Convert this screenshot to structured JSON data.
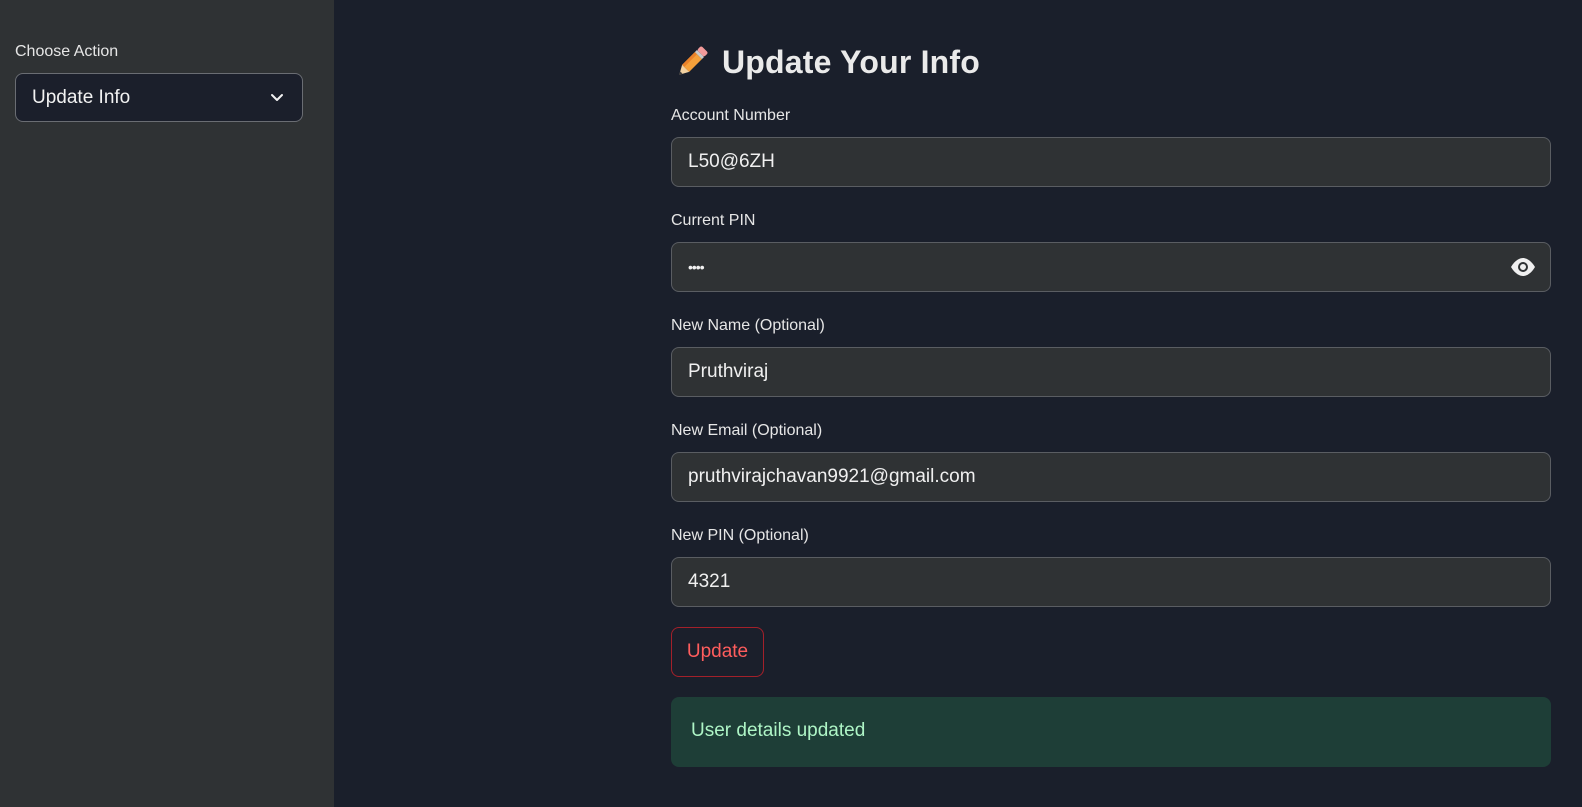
{
  "sidebar": {
    "choose_action_label": "Choose Action",
    "selected_action": "Update Info",
    "chevron_icon": "chevron-down-icon"
  },
  "main": {
    "title_icon": "pencil-icon",
    "title": "Update Your Info",
    "fields": {
      "account_number": {
        "label": "Account Number",
        "value": "L50@6ZH"
      },
      "current_pin": {
        "label": "Current PIN",
        "value": "••••",
        "toggle_icon": "eye-icon"
      },
      "new_name": {
        "label": "New Name (Optional)",
        "value": "Pruthviraj"
      },
      "new_email": {
        "label": "New Email (Optional)",
        "value": "pruthvirajchavan9921@gmail.com"
      },
      "new_pin": {
        "label": "New PIN (Optional)",
        "value": "4321"
      }
    },
    "update_button": "Update",
    "success_message": "User details updated"
  },
  "colors": {
    "background": "#1a1f2b",
    "sidebar": "#2f3234",
    "input": "#2f3234",
    "button_text": "#ff5d5d",
    "button_border": "#a3202a",
    "success_bg": "#1e3e37",
    "success_text": "#aef5c6"
  }
}
